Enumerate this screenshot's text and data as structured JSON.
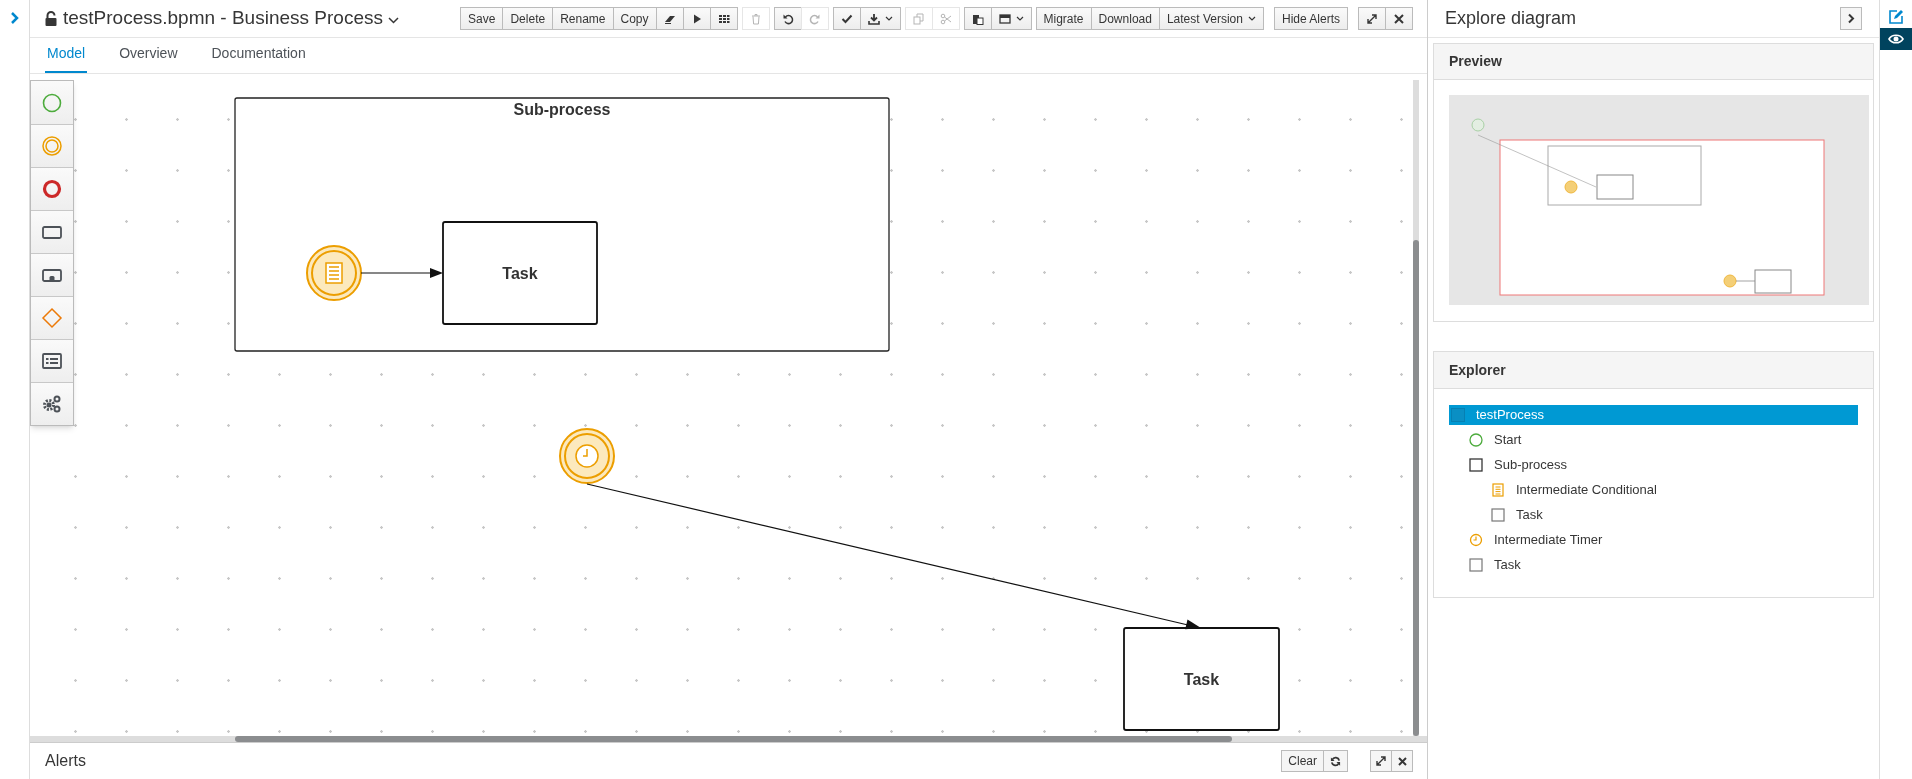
{
  "editor": {
    "title": "testProcess.bpmn - Business Process",
    "toolbar": [
      [
        {
          "label": "Save"
        },
        {
          "label": "Delete"
        },
        {
          "label": "Rename"
        },
        {
          "label": "Copy"
        },
        {
          "kind": "icon",
          "disabled": false
        },
        {
          "kind": "icon",
          "disabled": false
        },
        {
          "kind": "icon",
          "disabled": false
        }
      ],
      [
        {
          "kind": "icon",
          "disabled": true
        }
      ],
      [
        {
          "kind": "icon",
          "disabled": false
        },
        {
          "kind": "icon",
          "disabled": true
        }
      ],
      [
        {
          "kind": "icon",
          "disabled": false
        },
        {
          "kind": "icon",
          "disabled": false,
          "dropdown": true
        }
      ],
      [
        {
          "kind": "icon",
          "disabled": true
        },
        {
          "kind": "icon",
          "disabled": true
        }
      ],
      [
        {
          "kind": "icon",
          "disabled": false
        },
        {
          "kind": "icon",
          "disabled": false,
          "dropdown": true
        }
      ],
      [
        {
          "label": "Migrate"
        },
        {
          "label": "Download"
        },
        {
          "label": "Latest Version",
          "dropdown": true
        }
      ],
      [
        {
          "label": "Hide Alerts"
        }
      ],
      [
        {
          "kind": "icon",
          "disabled": false
        },
        {
          "kind": "icon",
          "disabled": false
        }
      ]
    ],
    "tabs": [
      {
        "label": "Model",
        "selected": true
      },
      {
        "label": "Overview",
        "selected": false
      },
      {
        "label": "Documentation",
        "selected": false
      }
    ],
    "diagram": {
      "nodes": [
        {
          "kind": "subprocess",
          "label": "Sub-process"
        },
        {
          "kind": "task",
          "label": "Task"
        },
        {
          "kind": "conditional-event"
        },
        {
          "kind": "timer-event"
        },
        {
          "kind": "task",
          "label": "Task"
        }
      ]
    },
    "alerts": {
      "title": "Alerts",
      "buttons": [
        {
          "label": "Clear"
        },
        {
          "kind": "icon"
        }
      ]
    }
  },
  "explore_panel": {
    "title": "Explore diagram",
    "preview": {
      "heading": "Preview"
    },
    "explorer": {
      "heading": "Explorer",
      "tree": [
        {
          "kind": "process",
          "label": "testProcess",
          "selected": true,
          "children": [
            {
              "kind": "start",
              "label": "Start",
              "selected": false
            },
            {
              "kind": "subprocess",
              "label": "Sub-process",
              "selected": false,
              "children": [
                {
                  "kind": "conditional",
                  "label": "Intermediate Conditional",
                  "selected": false
                },
                {
                  "kind": "task",
                  "label": "Task",
                  "selected": false
                }
              ]
            },
            {
              "kind": "timer",
              "label": "Intermediate Timer",
              "selected": false
            },
            {
              "kind": "task",
              "label": "Task",
              "selected": false
            }
          ]
        }
      ]
    }
  },
  "side_tabs": [
    {
      "selected": false
    },
    {
      "selected": true
    }
  ]
}
